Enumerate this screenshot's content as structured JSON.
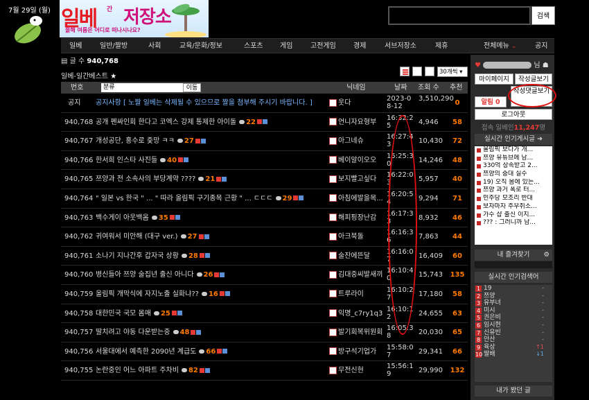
{
  "header": {
    "date_badge": "7월 29일 (월)",
    "banner_title_1": "일베",
    "banner_title_small": "간",
    "banner_title_2": "저장소",
    "banner_subtitle": "올해 여름은 어디로 떠나시나요?",
    "search_placeholder": "",
    "search_button": "검색"
  },
  "nav": {
    "items": [
      "일베",
      "일반/짤방",
      "사회",
      "교육/문화/정보",
      "스포츠",
      "게임",
      "고전게임",
      "경제",
      "서브저장소",
      "제휴"
    ],
    "all_menu": "전체메뉴",
    "notice": "공지"
  },
  "board": {
    "post_count_label": "글 수",
    "post_count": "940,768",
    "title": "일베-일간베스트",
    "per_page": "30개씩"
  },
  "table": {
    "headers": {
      "num": "번호",
      "category": "분류",
      "move": "이동",
      "author": "닉네임",
      "date": "날짜",
      "views": "조회 수",
      "rec": "추천"
    },
    "notice": {
      "num": "공지",
      "title": "공지사항 [ 노짤 일베는 삭제될 수 있으므로 짤을 첨부해 주시기 바랍니다. ]",
      "author": "웃다",
      "date": "2023-08-12",
      "views": "3,510,290",
      "rec": "0"
    },
    "rows": [
      {
        "num": "940,768",
        "title": "공개 펜싸인회 한다고 코엑스 강제 통제한 아이돌",
        "comments": "22",
        "author": "언니자요형부",
        "date": "16:32:25",
        "views": "4,946",
        "rec": "58"
      },
      {
        "num": "940,767",
        "title": "개성공단, 홍수로 줒망 ㅋㅋ",
        "comments": "27",
        "author": "아그네슈",
        "date": "16:27:43",
        "views": "10,430",
        "rec": "72"
      },
      {
        "num": "940,766",
        "title": "한서희 인스타 사진들",
        "comments": "40",
        "author": "베이알이오오",
        "date": "15:25:30",
        "views": "14,246",
        "rec": "48"
      },
      {
        "num": "940,765",
        "title": "쯔양과 전 소속사의 부당계약 ????",
        "comments": "21",
        "author": "보지빨고싶다",
        "date": "16:22:03",
        "views": "5,957",
        "rec": "40"
      },
      {
        "num": "940,764",
        "title": "\" 일본 vs 한국 \" ... \" 따라 올림픽 구기종목 근황 \" ... ㄷㄷㄷ",
        "comments": "29",
        "author": "아침에발을목...",
        "date": "16:20:54",
        "views": "9,294",
        "rec": "71"
      },
      {
        "num": "940,763",
        "title": "백수게이 아웃백옴",
        "comments": "35",
        "author": "해피핑장난감",
        "date": "16:17:33",
        "views": "8,932",
        "rec": "46"
      },
      {
        "num": "940,762",
        "title": "귀여워서 미안해 (대구 ver.)",
        "comments": "27",
        "author": "아크북돌",
        "date": "16:16:36",
        "views": "7,863",
        "rec": "44"
      },
      {
        "num": "940,761",
        "title": "소나기 지나간후 갑자국 상황",
        "comments": "28",
        "author": "술잔에뜬달",
        "date": "16:16:07",
        "views": "16,409",
        "rec": "60"
      },
      {
        "num": "940,760",
        "title": "병신들아 쯔양 술집년 출신 아니다",
        "comments": "26",
        "author": "김대중씨발새끼",
        "date": "16:10:40",
        "views": "15,743",
        "rec": "135"
      },
      {
        "num": "940,759",
        "title": "올림픽 개막식에 자지노출 실화냐??",
        "comments": "16",
        "author": "트루라이",
        "date": "16:10:27",
        "views": "17,180",
        "rec": "58"
      },
      {
        "num": "940,758",
        "title": "대한민국 국모 몸매",
        "comments": "25",
        "author": "익명_c7ry1q3",
        "date": "16:10:12",
        "views": "24,655",
        "rec": "63"
      },
      {
        "num": "940,757",
        "title": "딸치려고 야동 다운받는중",
        "comments": "48",
        "author": "발기회복위원회",
        "date": "16:05:38",
        "views": "20,030",
        "rec": "65"
      },
      {
        "num": "940,756",
        "title": "서울대에서 예측한 2090년 계급도",
        "comments": "66",
        "author": "방구석기업가",
        "date": "15:58:07",
        "views": "29,341",
        "rec": "66"
      },
      {
        "num": "940,755",
        "title": "논란중인 어느 아파트 주차비",
        "comments": "82",
        "author": "무전신현",
        "date": "15:56:19",
        "views": "29,990",
        "rec": "132"
      }
    ]
  },
  "sidebar": {
    "user_suffix": "님",
    "my_page": "마이페이지",
    "my_posts": "작성글보기",
    "my_comments": "작성댓글보기",
    "alarm_label": "알림",
    "alarm_count": "0",
    "logout": "로그아웃",
    "online_label": "접속 일베인",
    "online_count": "11,247",
    "online_suffix": "명",
    "hot_posts_title": "실시간 인기게시글 ➔",
    "hot_posts": [
      "올림픽 보다가 개...",
      "쯔양 유튜브에 남...",
      "330억 상속받고 2...",
      "쯔양의 중대 실수",
      "19) 오직 몸에 있는...",
      "쯔양 과거 폭로 터...",
      "민주당 모조리 반대",
      "보자마자 주우취소...",
      "가수 샵 출신 이지...",
      "??? : 그러니까 남..."
    ],
    "favorites_title": "내 즐겨찾기",
    "hot_search_title": "실시간 인기검색어",
    "keywords": [
      {
        "rank": "1",
        "word": "19",
        "change": "-"
      },
      {
        "rank": "2",
        "word": "쯔양",
        "change": "-"
      },
      {
        "rank": "3",
        "word": "유부녀",
        "change": "-"
      },
      {
        "rank": "4",
        "word": "미시",
        "change": "-"
      },
      {
        "rank": "5",
        "word": "권은비",
        "change": "-"
      },
      {
        "rank": "6",
        "word": "임시현",
        "change": "-"
      },
      {
        "rank": "7",
        "word": "신유빈",
        "change": "-"
      },
      {
        "rank": "8",
        "word": "안산",
        "change": "-"
      },
      {
        "rank": "9",
        "word": "육상",
        "change": "↑1"
      },
      {
        "rank": "10",
        "word": "딸배",
        "change": "↓1"
      }
    ],
    "my_posts_title": "내가 봤던 글"
  },
  "colors": {
    "accent_orange": "#ff7b00",
    "accent_red": "#e53935",
    "annotation": "#e01010",
    "notice_blue": "#7ab7ff"
  }
}
